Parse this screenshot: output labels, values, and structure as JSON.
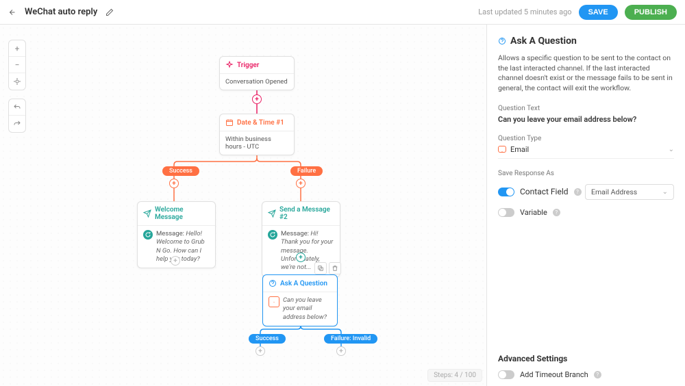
{
  "header": {
    "title": "WeChat auto reply",
    "last_updated": "Last updated 5 minutes ago",
    "save_label": "SAVE",
    "publish_label": "PUBLISH"
  },
  "canvas": {
    "steps_label": "Steps: 4 / 100",
    "nodes": {
      "trigger": {
        "title": "Trigger",
        "body": "Conversation Opened"
      },
      "datetime": {
        "title": "Date & Time #1",
        "body": "Within business hours - UTC"
      },
      "welcome": {
        "title": "Welcome Message",
        "prefix": "Message:",
        "body": "Hello! Welcome to Grub N Go. How can I help you today?"
      },
      "send2": {
        "title": "Send a Message #2",
        "prefix": "Message:",
        "body": "Hi! Thank you for your message. Unfortunately, we're not..."
      },
      "ask": {
        "title": "Ask A Question",
        "body": "Can you leave your email address below?"
      }
    },
    "branches": {
      "dt_success": "Success",
      "dt_failure": "Failure",
      "ask_success": "Success",
      "ask_failure": "Failure: Invalid"
    }
  },
  "sidebar": {
    "title": "Ask A Question",
    "description": "Allows a specific question to be sent to the contact on the last interacted channel. If the last interacted channel doesn't exist or the message fails to be sent in general, the contact will exit the workflow.",
    "question_text_label": "Question Text",
    "question_text_value": "Can you leave your email address below?",
    "question_type_label": "Question Type",
    "question_type_value": "Email",
    "save_response_label": "Save Response As",
    "contact_field_label": "Contact Field",
    "contact_field_select": "Email Address",
    "variable_label": "Variable",
    "advanced_label": "Advanced Settings",
    "timeout_label": "Add Timeout Branch"
  }
}
